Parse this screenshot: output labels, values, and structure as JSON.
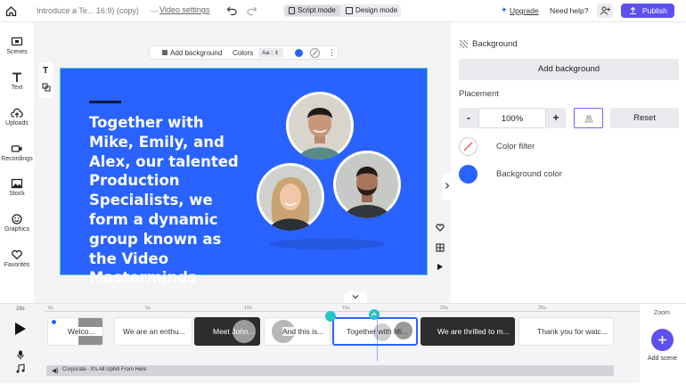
{
  "topbar": {
    "project_title": "Introduce a Te... 16:9) (copy)",
    "video_settings": "Video settings",
    "script_mode": "Script mode",
    "design_mode": "Design mode",
    "upgrade": "Upgrade",
    "need_help": "Need help?",
    "publish": "Publish"
  },
  "sidebar": {
    "items": [
      {
        "label": "Scenes",
        "icon": "scenes-icon"
      },
      {
        "label": "Text",
        "icon": "text-icon"
      },
      {
        "label": "Uploads",
        "icon": "upload-icon"
      },
      {
        "label": "Recordings",
        "icon": "video-camera-icon"
      },
      {
        "label": "Stock",
        "icon": "image-icon"
      },
      {
        "label": "Graphics",
        "icon": "smiley-icon"
      },
      {
        "label": "Favorites",
        "icon": "heart-icon"
      }
    ]
  },
  "canvas_toolbar": {
    "add_background": "Add background",
    "colors": "Colors",
    "font_size": "Aa"
  },
  "slide": {
    "background_color": "#2962ff",
    "heading": "Together with Mike, Emily, and Alex, our talented Production Specialists, we form a dynamic group known as the Video Masterminds"
  },
  "panel": {
    "title": "Background",
    "add_background": "Add background",
    "placement_label": "Placement",
    "minus": "-",
    "plus": "+",
    "zoom_value": "100%",
    "reset": "Reset",
    "color_filter": "Color filter",
    "background_color": "Background color",
    "accent": "#2962ff"
  },
  "timeline": {
    "duration": "29s",
    "ticks": [
      "0s",
      "5s",
      "10s",
      "15s",
      "20s",
      "25s"
    ],
    "clips": [
      {
        "label": "Welco..."
      },
      {
        "label": "We are an enthu..."
      },
      {
        "label": "Meet John..."
      },
      {
        "label": "And this is..."
      },
      {
        "label": "Together with Mi..."
      },
      {
        "label": "We are thrilled to m..."
      },
      {
        "label": "Thank you for watc..."
      }
    ],
    "audio_track": "Corporate - It's All Uphill From Here",
    "zoom_label": "Zoom",
    "add_scene": "Add scene"
  }
}
